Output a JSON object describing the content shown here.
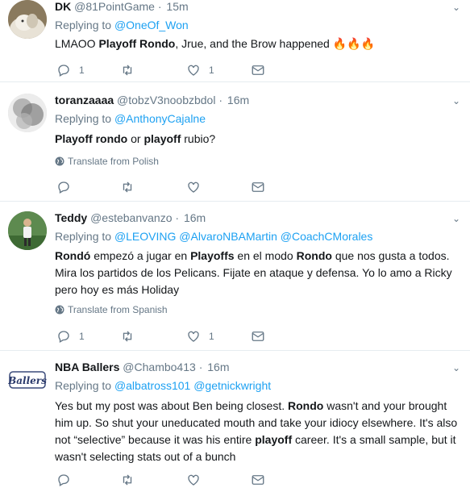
{
  "tweets": [
    {
      "name": "DK",
      "handle": "@81PointGame",
      "time": "15m",
      "replying_label": "Replying to",
      "replying_to": [
        "@OneOf_Won"
      ],
      "text_parts": [
        {
          "t": "LMAOO ",
          "b": false
        },
        {
          "t": "Playoff Rondo",
          "b": true
        },
        {
          "t": ", Jrue, and the Brow happened ",
          "b": false
        }
      ],
      "emoji": "🔥🔥🔥",
      "reply_count": "1",
      "retweet_count": "",
      "like_count": "1",
      "avatar": "dog-avatar"
    },
    {
      "name": "toranzaaaa",
      "handle": "@tobzV3noobzbdol",
      "time": "16m",
      "replying_label": "Replying to",
      "replying_to": [
        "@AnthonyCajalne"
      ],
      "text_parts": [
        {
          "t": "Playoff rondo",
          "b": true
        },
        {
          "t": " or ",
          "b": false
        },
        {
          "t": "playoff",
          "b": true
        },
        {
          "t": " rubio?",
          "b": false
        }
      ],
      "translate": "Translate from Polish",
      "reply_count": "",
      "retweet_count": "",
      "like_count": "",
      "avatar": "smoke-avatar"
    },
    {
      "name": "Teddy",
      "handle": "@estebanvanzo",
      "time": "16m",
      "replying_label": "Replying to",
      "replying_to": [
        "@LEOVING",
        "@AlvaroNBAMartin",
        "@CoachCMorales"
      ],
      "text_parts": [
        {
          "t": "Rondó",
          "b": true
        },
        {
          "t": " empezó a jugar en ",
          "b": false
        },
        {
          "t": "Playoffs",
          "b": true
        },
        {
          "t": " en el modo ",
          "b": false
        },
        {
          "t": "Rondo",
          "b": true
        },
        {
          "t": " que nos gusta a todos. Mira los partidos de los Pelicans. Fijate en ataque y defensa. Yo lo amo a Ricky pero hoy es más Holiday",
          "b": false
        }
      ],
      "translate": "Translate from Spanish",
      "reply_count": "1",
      "retweet_count": "",
      "like_count": "1",
      "avatar": "player-avatar"
    },
    {
      "name": "NBA Ballers",
      "handle": "@Chambo413",
      "time": "16m",
      "replying_label": "Replying to",
      "replying_to": [
        "@albatross101",
        "@getnickwright"
      ],
      "text_parts": [
        {
          "t": "Yes but my post was about Ben being closest. ",
          "b": false
        },
        {
          "t": "Rondo",
          "b": true
        },
        {
          "t": " wasn't and your brought him up. So shut your uneducated mouth and take your idiocy elsewhere. It's also not “selective” because it was his entire ",
          "b": false
        },
        {
          "t": "playoff",
          "b": true
        },
        {
          "t": " career. It's a small sample, but it wasn't selecting stats out of a bunch",
          "b": false
        }
      ],
      "reply_count": "",
      "retweet_count": "",
      "like_count": "",
      "avatar": "ballers-logo-avatar",
      "avatar_text": "Ballers"
    }
  ],
  "colors": {
    "link": "#1da1f2",
    "muted": "#657786",
    "text": "#14171a",
    "divider": "#e6ecf0"
  }
}
